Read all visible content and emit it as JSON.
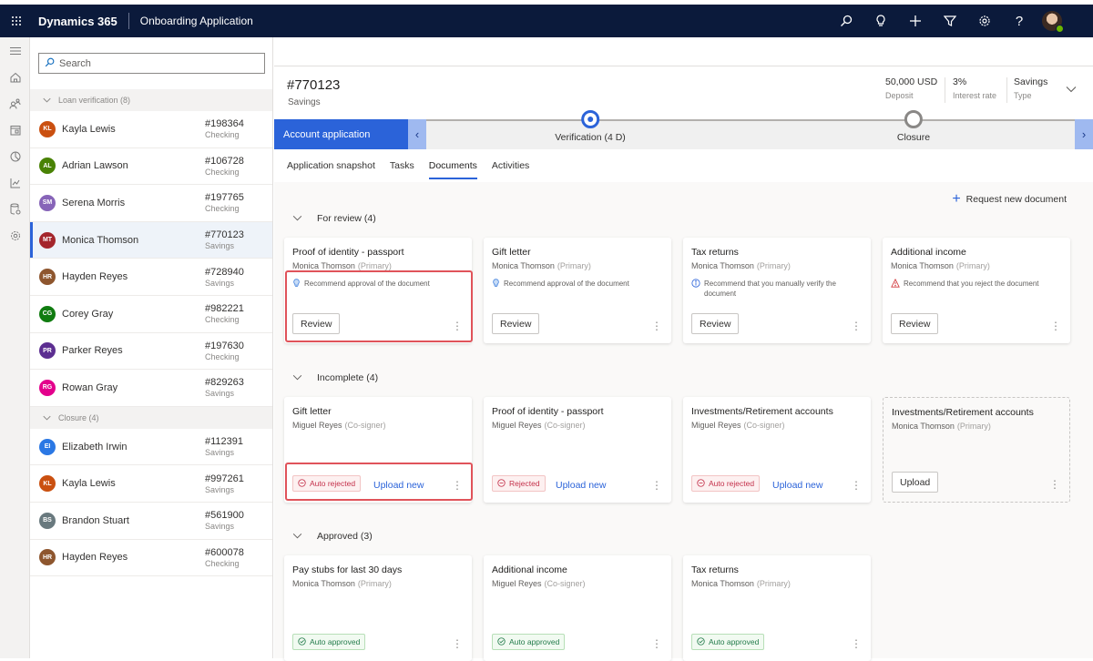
{
  "topbar": {
    "brand": "Dynamics 365",
    "app_name": "Onboarding Application",
    "icons": [
      "search-icon",
      "lightbulb-icon",
      "plus-icon",
      "filter-icon",
      "gear-icon",
      "help-icon"
    ]
  },
  "leftnav": {
    "icons": [
      "hamburger-icon",
      "home-icon",
      "people-icon",
      "calendar-icon",
      "pie-chart-icon",
      "line-chart-icon",
      "database-icon",
      "settings-icon"
    ]
  },
  "list": {
    "search_placeholder": "Search",
    "groups": [
      {
        "label": "Loan verification (8)",
        "items": [
          {
            "initials": "KL",
            "name": "Kayla Lewis",
            "account": "#198364",
            "type": "Checking",
            "color": "#ca5010"
          },
          {
            "initials": "AL",
            "name": "Adrian Lawson",
            "account": "#106728",
            "type": "Checking",
            "color": "#498205"
          },
          {
            "initials": "SM",
            "name": "Serena Morris",
            "account": "#197765",
            "type": "Checking",
            "color": "#8764b8"
          },
          {
            "initials": "MT",
            "name": "Monica Thomson",
            "account": "#770123",
            "type": "Savings",
            "color": "#a4262c",
            "selected": true
          },
          {
            "initials": "HR",
            "name": "Hayden Reyes",
            "account": "#728940",
            "type": "Savings",
            "color": "#8e562e"
          },
          {
            "initials": "CG",
            "name": "Corey Gray",
            "account": "#982221",
            "type": "Checking",
            "color": "#107c10"
          },
          {
            "initials": "PR",
            "name": "Parker Reyes",
            "account": "#197630",
            "type": "Checking",
            "color": "#5c2e91"
          },
          {
            "initials": "RG",
            "name": "Rowan Gray",
            "account": "#829263",
            "type": "Savings",
            "color": "#e3008c"
          }
        ]
      },
      {
        "label": "Closure (4)",
        "items": [
          {
            "initials": "EI",
            "name": "Elizabeth Irwin",
            "account": "#112391",
            "type": "Savings",
            "color": "#2b78e4"
          },
          {
            "initials": "KL",
            "name": "Kayla Lewis",
            "account": "#997261",
            "type": "Savings",
            "color": "#ca5010"
          },
          {
            "initials": "BS",
            "name": "Brandon Stuart",
            "account": "#561900",
            "type": "Savings",
            "color": "#69797e"
          },
          {
            "initials": "HR",
            "name": "Hayden Reyes",
            "account": "#600078",
            "type": "Checking",
            "color": "#8e562e"
          }
        ]
      }
    ]
  },
  "record": {
    "title": "#770123",
    "subtitle": "Savings",
    "fields": [
      {
        "value": "50,000 USD",
        "label": "Deposit"
      },
      {
        "value": "3%",
        "label": "Interest rate"
      },
      {
        "value": "Savings",
        "label": "Type"
      }
    ]
  },
  "process": {
    "active_stage": "Account application",
    "stages": [
      {
        "label": "Verification (4 D)",
        "state": "current"
      },
      {
        "label": "Closure",
        "state": "future"
      }
    ]
  },
  "tabs": [
    {
      "label": "Application snapshot",
      "active": false
    },
    {
      "label": "Tasks",
      "active": false
    },
    {
      "label": "Documents",
      "active": true
    },
    {
      "label": "Activities",
      "active": false
    }
  ],
  "documents": {
    "request_label": "Request new document",
    "sections": [
      {
        "title": "For review (4)",
        "cards": [
          {
            "title": "Proof of identity - passport",
            "person": "Monica Thomson",
            "role": "(Primary)",
            "rec_icon": "lightbulb",
            "rec": "Recommend approval of the document",
            "button": "Review",
            "highlight": true
          },
          {
            "title": "Gift letter",
            "person": "Monica Thomson",
            "role": "(Primary)",
            "rec_icon": "lightbulb",
            "rec": "Recommend approval of the document",
            "button": "Review"
          },
          {
            "title": "Tax returns",
            "person": "Monica Thomson",
            "role": "(Primary)",
            "rec_icon": "info",
            "rec": "Recommend that you manually verify the document",
            "button": "Review"
          },
          {
            "title": "Additional income",
            "person": "Monica Thomson",
            "role": "(Primary)",
            "rec_icon": "warning",
            "rec": "Recommend that you reject the document",
            "button": "Review"
          }
        ]
      },
      {
        "title": "Incomplete (4)",
        "cards": [
          {
            "title": "Gift letter",
            "person": "Miguel Reyes",
            "role": "(Co-signer)",
            "status": "Auto rejected",
            "status_kind": "rejected",
            "link": "Upload new",
            "highlight": true
          },
          {
            "title": "Proof of identity - passport",
            "person": "Miguel Reyes",
            "role": "(Co-signer)",
            "status": "Rejected",
            "status_kind": "rejected",
            "link": "Upload new"
          },
          {
            "title": "Investments/Retirement accounts",
            "person": "Miguel Reyes",
            "role": "(Co-signer)",
            "status": "Auto rejected",
            "status_kind": "rejected",
            "link": "Upload new"
          },
          {
            "title": "Investments/Retirement accounts",
            "person": "Monica Thomson",
            "role": "(Primary)",
            "button": "Upload",
            "dashed": true
          }
        ]
      },
      {
        "title": "Approved (3)",
        "cards": [
          {
            "title": "Pay stubs for last 30 days",
            "person": "Monica Thomson",
            "role": "(Primary)",
            "status": "Auto approved",
            "status_kind": "approved"
          },
          {
            "title": "Additional income",
            "person": "Miguel Reyes",
            "role": "(Co-signer)",
            "status": "Auto approved",
            "status_kind": "approved"
          },
          {
            "title": "Tax returns",
            "person": "Monica Thomson",
            "role": "(Primary)",
            "status": "Auto approved",
            "status_kind": "approved"
          }
        ]
      }
    ]
  }
}
